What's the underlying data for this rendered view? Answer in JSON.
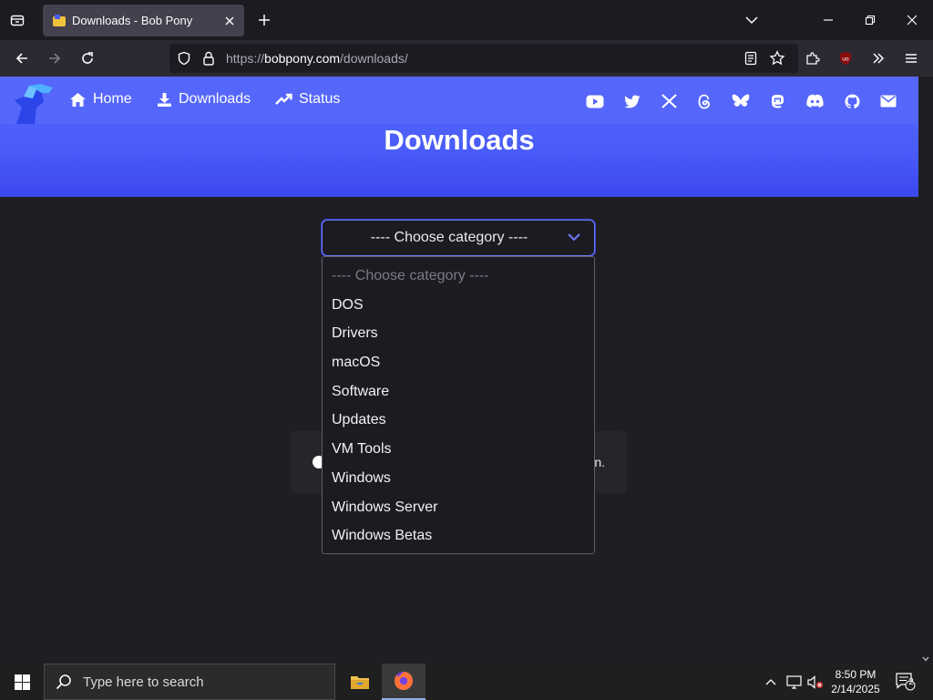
{
  "browser": {
    "tab": {
      "title": "Downloads - Bob Pony"
    },
    "url": {
      "prefix": "https://",
      "host": "bobpony.com",
      "path": "/downloads/"
    }
  },
  "site": {
    "nav": [
      {
        "label": "Home",
        "icon": "home-icon"
      },
      {
        "label": "Downloads",
        "icon": "download-icon"
      },
      {
        "label": "Status",
        "icon": "trending-up-icon"
      }
    ],
    "social_icons": [
      "youtube-icon",
      "twitter-icon",
      "x-icon",
      "threads-icon",
      "bluesky-icon",
      "mastodon-icon",
      "discord-icon",
      "github-icon",
      "email-icon"
    ],
    "title": "Downloads",
    "category_select": {
      "value": "---- Choose category ----",
      "options": [
        "---- Choose category ----",
        "DOS",
        "Drivers",
        "macOS",
        "Software",
        "Updates",
        "VM Tools",
        "Windows",
        "Windows Server",
        "Windows Betas"
      ]
    },
    "info_tail": "n."
  },
  "taskbar": {
    "search_placeholder": "Type here to search",
    "time": "8:50 PM",
    "date": "2/14/2025",
    "notifications": "2"
  },
  "colors": {
    "accent": "#5566fb",
    "hero_bottom": "#3c48ef",
    "page_bg": "#1f1f23"
  }
}
